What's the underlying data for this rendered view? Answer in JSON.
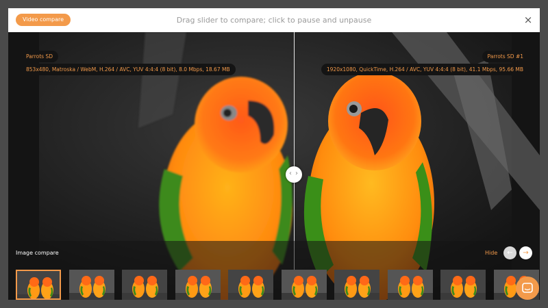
{
  "header": {
    "mode_button_label": "Video compare",
    "instruction": "Drag slider to compare; click to pause and unpause",
    "close_glyph": "×"
  },
  "left_video": {
    "name": "Parrots SD",
    "info": "853x480, Matroska / WebM, H.264 / AVC, YUV 4:4:4 (8 bit), 8.0 Mbps, 18.67 MB"
  },
  "right_video": {
    "name": "Parrots SD #1",
    "info": "1920x1080, QuickTime, H.264 / AVC, YUV 4:4:4 (8 bit), 41.1 Mbps, 95.66 MB"
  },
  "slider": {
    "left_arrow": "‹",
    "right_arrow": "›"
  },
  "image_strip": {
    "title": "Image compare",
    "hide_label": "Hide",
    "prev_glyph": "←",
    "next_glyph": "→",
    "thumbnail_count": 10,
    "active_index": 0
  },
  "colors": {
    "accent": "#f39a4a",
    "header_bg": "#ffffff",
    "stage_bg": "#101010"
  },
  "icons": [
    "close-icon",
    "chevron-left-icon",
    "chevron-right-icon",
    "arrow-left-icon",
    "arrow-right-icon",
    "chat-icon"
  ]
}
